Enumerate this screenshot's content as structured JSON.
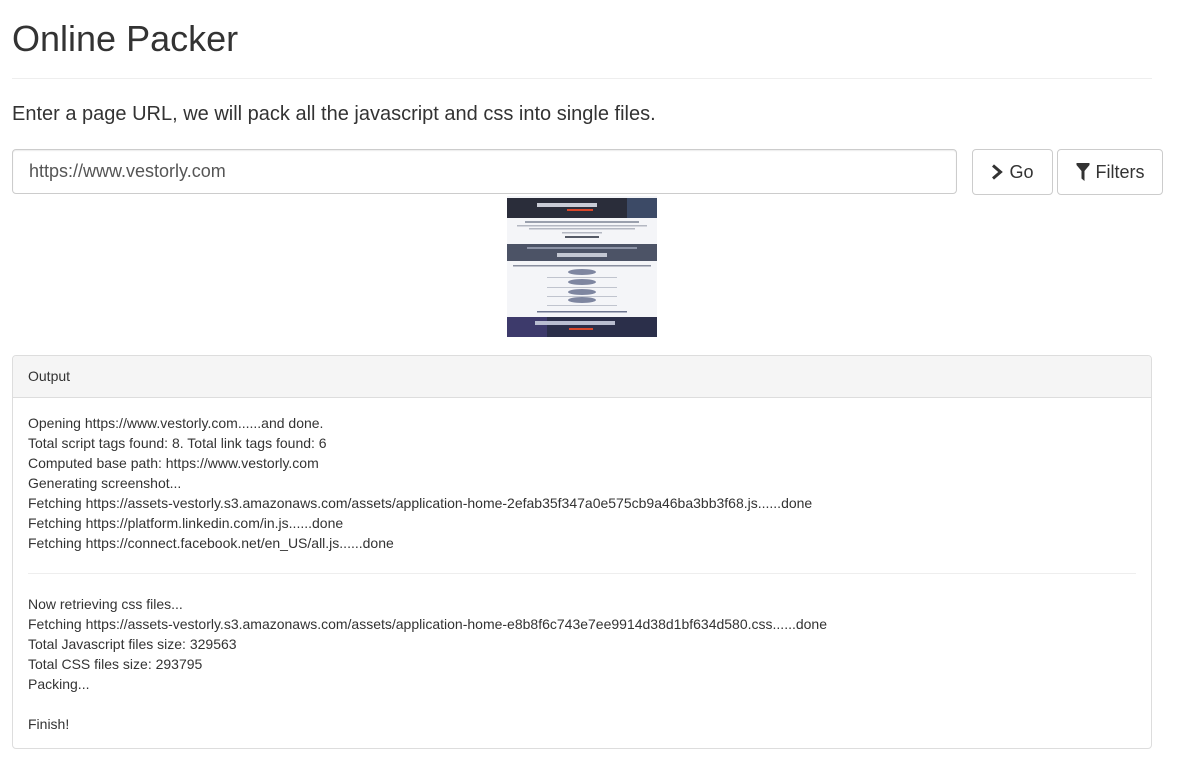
{
  "page": {
    "title": "Online Packer",
    "lead": "Enter a page URL, we will pack all the javascript and css into single files."
  },
  "form": {
    "url_value": "https://www.vestorly.com",
    "go_label": "Go",
    "filters_label": "Filters",
    "go_icon": "chevron-right-icon",
    "filters_icon": "filter-icon"
  },
  "output": {
    "heading": "Output",
    "js_lines": [
      "Opening https://www.vestorly.com......and done.",
      "Total script tags found: 8. Total link tags found: 6",
      "Computed base path: https://www.vestorly.com",
      "Generating screenshot...",
      "Fetching https://assets-vestorly.s3.amazonaws.com/assets/application-home-2efab35f347a0e575cb9a46ba3bb3f68.js......done",
      "Fetching https://platform.linkedin.com/in.js......done",
      "Fetching https://connect.facebook.net/en_US/all.js......done"
    ],
    "css_lines": [
      "Now retrieving css files...",
      "Fetching https://assets-vestorly.s3.amazonaws.com/assets/application-home-e8b8f6c743e7ee9914d38d1bf634d580.css......done",
      "Total Javascript files size: 329563",
      "Total CSS files size: 293795",
      "Packing..."
    ],
    "finish": "Finish!"
  },
  "colors": {
    "border": "#cccccc",
    "panel_heading_bg": "#f5f5f5",
    "text": "#333333"
  }
}
